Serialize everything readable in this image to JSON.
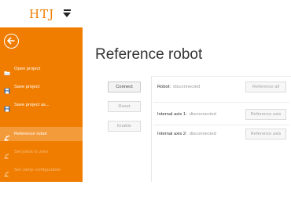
{
  "header": {
    "logo_text": "HTJ",
    "menu_icon": "dropdown-arrow-icon"
  },
  "sidebar": {
    "back_icon": "back-arrow-icon",
    "items": [
      {
        "label": "Open project",
        "icon": "open-folder-icon",
        "state": "normal"
      },
      {
        "label": "Save project",
        "icon": "save-icon",
        "state": "normal"
      },
      {
        "label": "Save project as...",
        "icon": "save-as-icon",
        "state": "normal"
      },
      {
        "label": "Reference robot",
        "icon": "robot-arm-icon",
        "state": "active"
      },
      {
        "label": "Set joints to zero",
        "icon": "joints-icon",
        "state": "disabled"
      },
      {
        "label": "Set Jamp configuration",
        "icon": "configuration-icon",
        "state": "disabled"
      }
    ]
  },
  "main": {
    "title": "Reference robot",
    "buttons": {
      "connect": "Connect",
      "reset": "Reset",
      "enable": "Enable"
    },
    "rows": [
      {
        "label": "Robot:",
        "status": "disconnected",
        "action": "Reference all"
      },
      {
        "label": "Internal axis 1:",
        "status": "disconnected",
        "action": "Reference axis"
      },
      {
        "label": "Internal axis 2:",
        "status": "disconnected",
        "action": "Reference axis"
      }
    ]
  },
  "colors": {
    "accent": "#f07d00",
    "active_item": "#f39a3a",
    "text": "#333333",
    "muted": "#9a9a9a"
  }
}
